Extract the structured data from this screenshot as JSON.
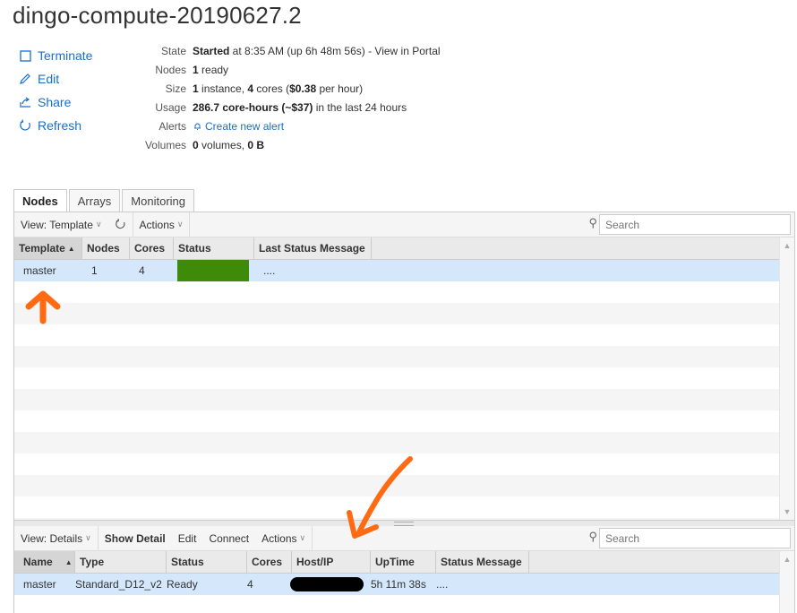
{
  "title": "dingo-compute-20190627.2",
  "actions": [
    {
      "label": "Terminate",
      "icon": "square-icon"
    },
    {
      "label": "Edit",
      "icon": "pencil-icon"
    },
    {
      "label": "Share",
      "icon": "share-icon"
    },
    {
      "label": "Refresh",
      "icon": "refresh-icon"
    }
  ],
  "props": {
    "state": {
      "label": "State",
      "bold": "Started",
      "rest": " at 8:35 AM (up 6h 48m 56s) - View in Portal"
    },
    "nodes": {
      "label": "Nodes",
      "bold": "1",
      "rest": " ready"
    },
    "size": {
      "label": "Size",
      "b1": "1",
      "t1": " instance, ",
      "b2": "4",
      "t2": " cores (",
      "b3": "$0.38",
      "t3": " per hour)"
    },
    "usage": {
      "label": "Usage",
      "bold": "286.7 core-hours (~$37)",
      "rest": " in the last 24 hours"
    },
    "alerts": {
      "label": "Alerts",
      "link": "Create new alert"
    },
    "volumes": {
      "label": "Volumes",
      "b1": "0",
      "t1": " volumes, ",
      "b2": "0 B"
    }
  },
  "tabs": [
    "Nodes",
    "Arrays",
    "Monitoring"
  ],
  "top_toolbar": {
    "view": "View: Template",
    "actions": "Actions",
    "search_placeholder": "Search"
  },
  "top_grid": {
    "columns": [
      "Template",
      "Nodes",
      "Cores",
      "Status",
      "Last Status Message"
    ],
    "rows": [
      {
        "template": "master",
        "nodes": "1",
        "cores": "4",
        "status_fraction": 1.0,
        "message": "...."
      }
    ]
  },
  "bottom_toolbar": {
    "view": "View: Details",
    "show_detail": "Show Detail",
    "edit": "Edit",
    "connect": "Connect",
    "actions": "Actions",
    "search_placeholder": "Search"
  },
  "bottom_grid": {
    "columns": [
      "Name",
      "Type",
      "Status",
      "Cores",
      "Host/IP",
      "UpTime",
      "Status Message"
    ],
    "rows": [
      {
        "name": "master",
        "type": "Standard_D12_v2",
        "status": "Ready",
        "cores": "4",
        "uptime": "5h 11m 38s",
        "message": "...."
      }
    ]
  },
  "colors": {
    "accent": "#1a6fc8",
    "status_ok": "#3e8b0a",
    "selection": "#d4e7fb",
    "annotation": "#ff6a13"
  }
}
